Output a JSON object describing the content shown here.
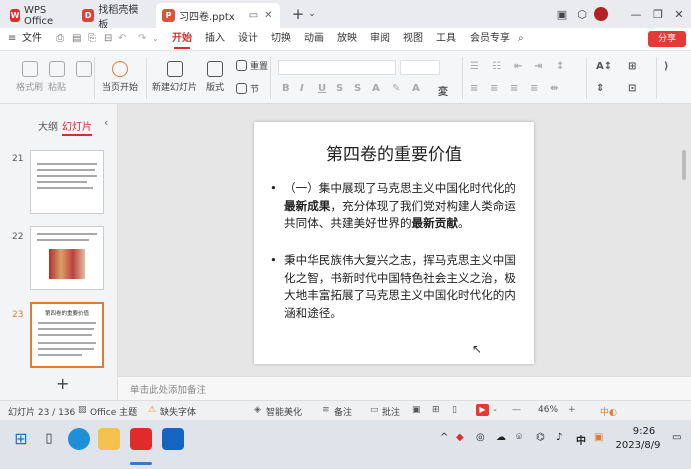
{
  "tabs": [
    {
      "label": "WPS Office",
      "icon": "wps-logo-icon",
      "color": "#e02b2b"
    },
    {
      "label": "找稻壳模板",
      "icon": "docer-icon",
      "color": "#d9443a"
    },
    {
      "label": "习四卷.pptx",
      "icon": "pptx-file-icon",
      "color": "#d9543a"
    }
  ],
  "new_tab": "+",
  "menu": {
    "file": "文件",
    "items": [
      "开始",
      "插入",
      "设计",
      "切换",
      "动画",
      "放映",
      "审阅",
      "视图",
      "工具",
      "会员专享"
    ],
    "active": "开始",
    "share": "分享"
  },
  "ribbon": {
    "format_painter": "格式刷",
    "paste": "粘贴",
    "from_current": "当页开始",
    "new_slide": "新建幻灯片",
    "layout": "版式",
    "section": "节",
    "reset": "重置"
  },
  "left_pane": {
    "outline_tab": "大纲",
    "slides_tab": "幻灯片",
    "add": "+"
  },
  "thumbs": [
    {
      "num": "21"
    },
    {
      "num": "22"
    },
    {
      "num": "23",
      "title": "第四卷的重要价值"
    }
  ],
  "slide": {
    "title": "第四卷的重要价值",
    "b1": {
      "p1": "（一）集中展现了马克思主义中国化时代化的",
      "s1": "最新成果",
      "p2": "，充分体现了我们党对构建人类命运共同体、共建美好世界的",
      "s2": "最新贡献",
      "p3": "。"
    },
    "b2": "秉中华民族伟大复兴之志，挥马克思主义中国化之智，书新时代中国特色社会主义之治，极大地丰富拓展了马克思主义中国化时代化的内涵和途径。"
  },
  "notes_placeholder": "单击此处添加备注",
  "status": {
    "slide_count": "幻灯片 23 / 136",
    "theme": "Office 主题",
    "missing_font": "缺失字体",
    "beautify": "智能美化",
    "notes": "备注",
    "comment": "批注",
    "zoom": "46%"
  },
  "taskbar": {
    "ime": "中",
    "time": "9:26",
    "date": "2023/8/9"
  },
  "colors": {
    "accent": "#d32f2f",
    "tab_active": "#ffffff",
    "titlebar": "#e9ebee"
  }
}
